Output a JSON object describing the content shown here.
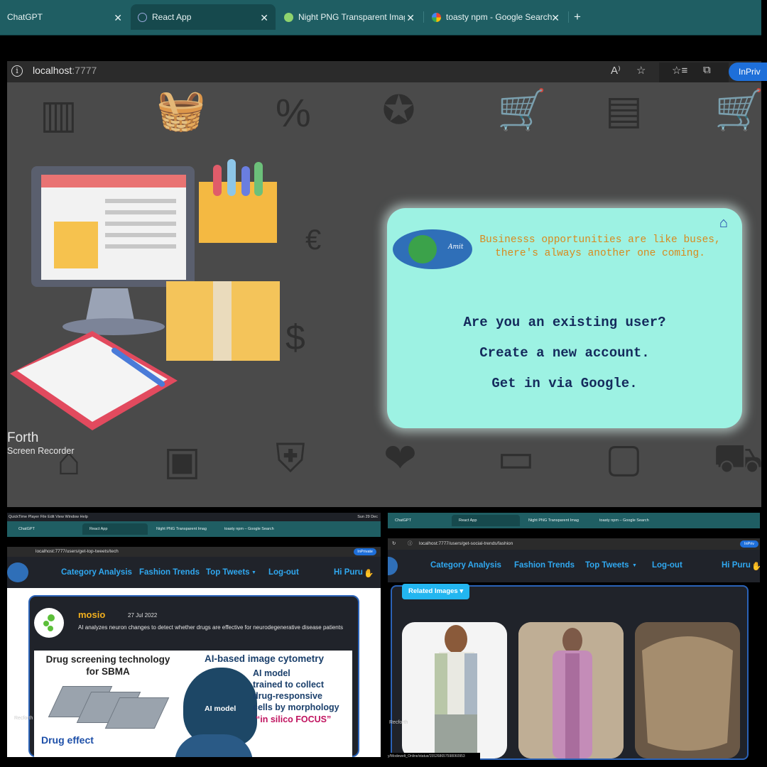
{
  "top": {
    "tabs": [
      {
        "label": "ChatGPT"
      },
      {
        "label": "React App"
      },
      {
        "label": "Night PNG Transparent Images"
      },
      {
        "label": "toasty npm - Google Search"
      }
    ],
    "address": {
      "host": "localhost",
      "port": ":7777"
    },
    "inprivate_label": "InPriv",
    "card": {
      "quote_line1": "Businesss opportunities are like buses,",
      "quote_line2": "there's always another one coming.",
      "options": [
        "Are you an existing user?",
        "Create a new account.",
        "Get in via Google."
      ],
      "logo_text": "Amit"
    },
    "recorder": {
      "title": "Forth",
      "subtitle": "Screen Recorder"
    }
  },
  "bottom_left": {
    "menubar": "QuickTime Player   File   Edit   View   Window   Help",
    "clock": "Sun 29 Dec",
    "tabs": [
      "ChatGPT",
      "React App",
      "Night PNG Transparent Imag",
      "toasty npm – Google Search"
    ],
    "address": "localhost:7777/users/get-top-tweets/tech",
    "inprivate_label": "InPrivate",
    "nav": {
      "category": "Category Analysis",
      "fashion": "Fashion Trends",
      "tweets": "Top Tweets",
      "logout": "Log-out",
      "greeting": "Hi Puru"
    },
    "tweet": {
      "user": "mosio",
      "date": "27 Jul 2022",
      "text": "AI analyzes neuron changes to detect whether drugs are effective for neurodegenerative disease patients"
    },
    "image": {
      "left_title": "Drug screening technology for SBMA",
      "right_title": "AI-based image cytometry",
      "ai_text_1": "AI model",
      "ai_text_2": "trained to collect",
      "ai_text_3": "drug-responsive",
      "ai_text_4": "cells by morphology",
      "silico": "“in silico FOCUS”",
      "drug_effect": "Drug effect",
      "head_label": "AI model"
    },
    "recorder": "Recforth"
  },
  "bottom_right": {
    "tabs": [
      "ChatGPT",
      "React App",
      "Night PNG Transparent Imag",
      "toasty npm – Google Search"
    ],
    "address": "localhost:7777/users/get-social-trends/fashion",
    "inprivate_label": "InPriv",
    "nav": {
      "category": "Category Analysis",
      "fashion": "Fashion Trends",
      "tweets": "Top Tweets",
      "logout": "Log-out",
      "greeting": "Hi Puru"
    },
    "related_button": "Related Images",
    "status_url": "y/Modewelt_Online/status/155268657598060953",
    "recorder": "Recforth"
  },
  "colors": {
    "tab_bar": "#1f5e63",
    "card_bg": "#9df2e3",
    "nav_link": "#30a8f0",
    "accent_blue": "#1e6fd9"
  }
}
